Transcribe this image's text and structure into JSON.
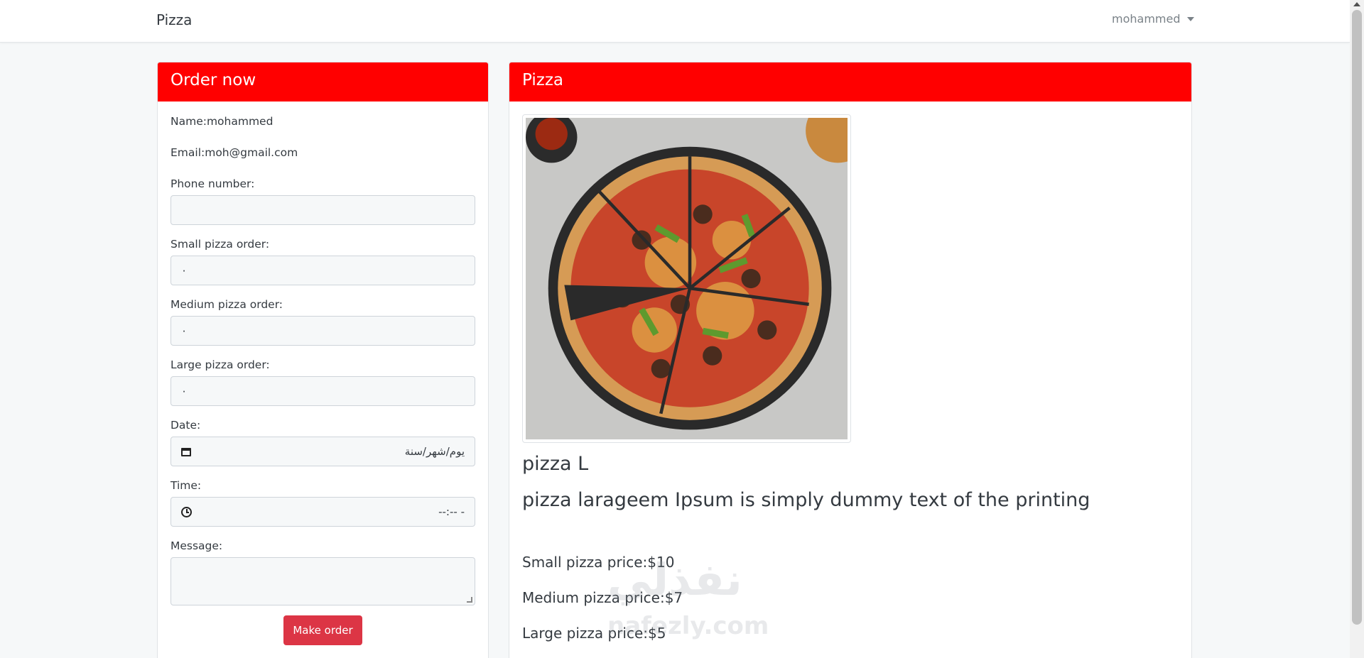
{
  "navbar": {
    "brand": "Pizza",
    "user": "mohammed"
  },
  "order": {
    "header": "Order now",
    "name_line": "Name:mohammed",
    "email_line": "Email:moh@gmail.com",
    "phone_label": "Phone number:",
    "phone_value": "",
    "small_label": "Small pizza order:",
    "small_value": "٠",
    "medium_label": "Medium pizza order:",
    "medium_value": "٠",
    "large_label": "Large pizza order:",
    "large_value": "٠",
    "date_label": "Date:",
    "date_value": "يوم/شهر/سنة",
    "time_label": "Time:",
    "time_value": "--:-- -",
    "message_label": "Message:",
    "submit_label": "Make order"
  },
  "pizza": {
    "header": "Pizza",
    "title": "pizza L",
    "description": "pizza larageem Ipsum is simply dummy text of the printing",
    "small_price": "Small pizza price:$10",
    "medium_price": "Medium pizza price:$7",
    "large_price": "Large pizza price:$5"
  },
  "watermark": {
    "arabic": "نفذلي",
    "latin": "nafezly.com"
  },
  "colors": {
    "header": "#ff0000",
    "button": "#dc3545",
    "background": "#f6f8f9"
  },
  "icons": {
    "user_caret": "caret-down-icon",
    "date": "calendar-icon",
    "time": "clock-icon"
  }
}
